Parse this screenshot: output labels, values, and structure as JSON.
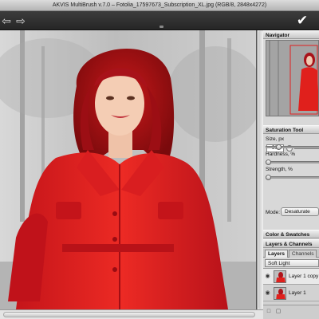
{
  "window": {
    "title": "AKVIS MultiBrush v.7.0 – Fotolia_17597673_Subscription_XL.jpg (RGB/8, 2848x4272)"
  },
  "toolbar": {
    "back_icon": "⇦",
    "forward_icon": "⇨",
    "apply_icon": "✔"
  },
  "navigator": {
    "title": "Navigator",
    "zoom": "50%",
    "zoom_minus": "−"
  },
  "saturation_tool": {
    "title": "Saturation Tool",
    "size_label": "Size, px",
    "hardness_label": "Hardness, %",
    "strength_label": "Strength, %",
    "mode_label": "Mode:",
    "mode_value": "Desaturate",
    "size_level": 0.22,
    "hardness_level": 0.0,
    "strength_level": 0.0
  },
  "color_swatches": {
    "title": "Color & Swatches"
  },
  "layers_channels": {
    "title": "Layers & Channels",
    "tabs": [
      "Layers",
      "Channels"
    ],
    "blend_mode": "Soft Light",
    "layers": [
      {
        "name": "Layer 1 copy",
        "selected": true
      },
      {
        "name": "Layer 1",
        "selected": false
      }
    ]
  },
  "colors": {
    "accent_red": "#e0201c",
    "toolbar_bg": "#2e2e2e",
    "panel_bg": "#d8d8d8"
  }
}
